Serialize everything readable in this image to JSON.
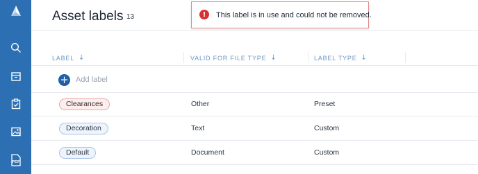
{
  "page": {
    "title": "Asset labels",
    "count": "13"
  },
  "toast": {
    "message": "This label is in use and could not be removed.",
    "icon": "error-icon",
    "icon_glyph": "!",
    "color": "#d93030"
  },
  "sidebar": {
    "color": "#2c6fb3",
    "items": [
      {
        "icon": "logo-icon"
      },
      {
        "icon": "search-icon"
      },
      {
        "icon": "box-icon"
      },
      {
        "icon": "clipboard-check-icon"
      },
      {
        "icon": "image-icon"
      },
      {
        "icon": "pdf-icon",
        "text": "PDF"
      }
    ]
  },
  "table": {
    "columns": [
      {
        "label": "LABEL",
        "arrow": "↓"
      },
      {
        "label": "VALID FOR FILE TYPE",
        "arrow": "↓"
      },
      {
        "label": "LABEL TYPE",
        "arrow": "↓"
      }
    ],
    "add_label": {
      "icon_glyph": "+",
      "text": "Add label"
    },
    "rows": [
      {
        "label": "Clearances",
        "chip_color": "red",
        "file_type": "Other",
        "label_type": "Preset"
      },
      {
        "label": "Decoration",
        "chip_color": "blue",
        "file_type": "Text",
        "label_type": "Custom"
      },
      {
        "label": "Default",
        "chip_color": "blue",
        "file_type": "Document",
        "label_type": "Custom"
      }
    ]
  }
}
